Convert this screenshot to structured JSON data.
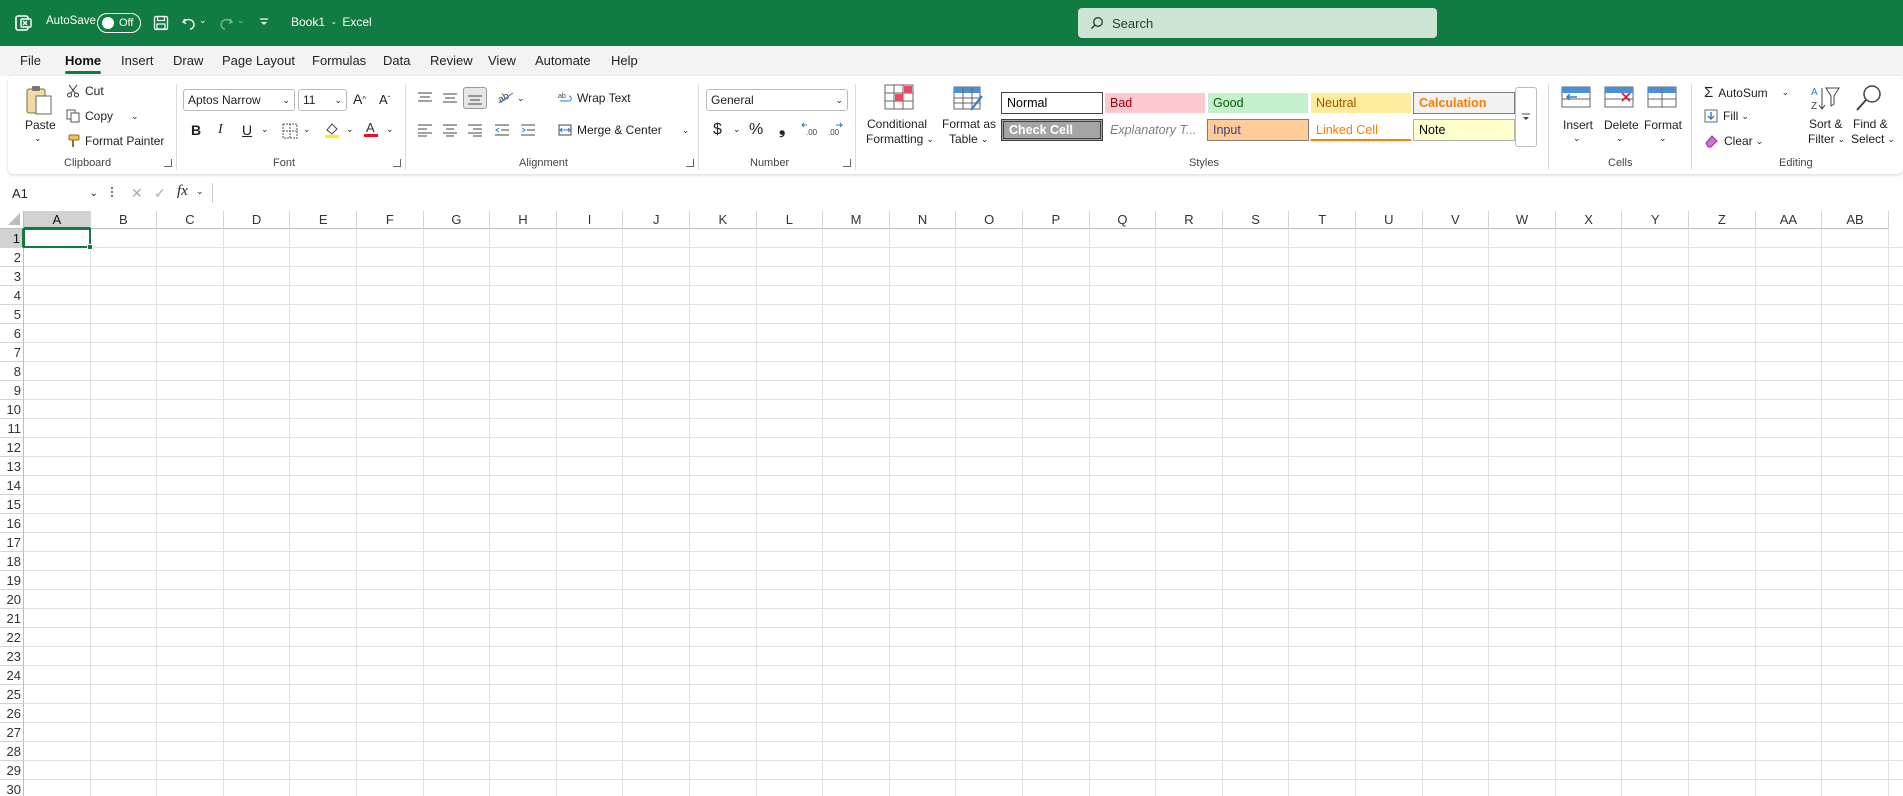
{
  "titlebar": {
    "autosave_label": "AutoSave",
    "autosave_state": "Off",
    "doc_title": "Book1",
    "separator": "-",
    "app_name": "Excel",
    "search_placeholder": "Search"
  },
  "menu": [
    "File",
    "Home",
    "Insert",
    "Draw",
    "Page Layout",
    "Formulas",
    "Data",
    "Review",
    "View",
    "Automate",
    "Help"
  ],
  "clipboard": {
    "paste": "Paste",
    "cut": "Cut",
    "copy": "Copy",
    "format_painter": "Format Painter",
    "group": "Clipboard"
  },
  "font": {
    "name": "Aptos Narrow",
    "size": "11",
    "bold": "B",
    "italic": "I",
    "underline": "U",
    "group": "Font"
  },
  "alignment": {
    "wrap": "Wrap Text",
    "merge": "Merge & Center",
    "group": "Alignment"
  },
  "number": {
    "format": "General",
    "currency": "$",
    "percent": "%",
    "comma": "❟",
    "group": "Number"
  },
  "styles": {
    "conditional_1": "Conditional",
    "conditional_2": "Formatting",
    "format_table_1": "Format as",
    "format_table_2": "Table",
    "cells": [
      {
        "label": "Normal",
        "bg": "#ffffff",
        "fg": "#000000"
      },
      {
        "label": "Bad",
        "bg": "#ffc7ce",
        "fg": "#9c0006"
      },
      {
        "label": "Good",
        "bg": "#c6efce",
        "fg": "#006100"
      },
      {
        "label": "Neutral",
        "bg": "#ffeb9c",
        "fg": "#9c5700"
      },
      {
        "label": "Calculation",
        "bg": "#f2f2f2",
        "fg": "#fa7d00"
      },
      {
        "label": "Check Cell",
        "bg": "#a5a5a5",
        "fg": "#ffffff"
      },
      {
        "label": "Explanatory T...",
        "bg": "#ffffff",
        "fg": "#7f7f7f"
      },
      {
        "label": "Input",
        "bg": "#ffcc99",
        "fg": "#3f3f76"
      },
      {
        "label": "Linked Cell",
        "bg": "#ffffff",
        "fg": "#fa7d00"
      },
      {
        "label": "Note",
        "bg": "#ffffcc",
        "fg": "#000000"
      }
    ],
    "group": "Styles"
  },
  "cells_group": {
    "insert": "Insert",
    "delete": "Delete",
    "format": "Format",
    "group": "Cells"
  },
  "editing": {
    "autosum": "AutoSum",
    "fill": "Fill",
    "clear": "Clear",
    "sort_1": "Sort &",
    "sort_2": "Filter",
    "find_1": "Find &",
    "find_2": "Select",
    "group": "Editing"
  },
  "formula": {
    "name_box": "A1",
    "fx": "fx",
    "content": ""
  },
  "sheet": {
    "columns": [
      "A",
      "B",
      "C",
      "D",
      "E",
      "F",
      "G",
      "H",
      "I",
      "J",
      "K",
      "L",
      "M",
      "N",
      "O",
      "P",
      "Q",
      "R",
      "S",
      "T",
      "U",
      "V",
      "W",
      "X",
      "Y",
      "Z",
      "AA",
      "AB"
    ],
    "rows": [
      "1",
      "2",
      "3",
      "4",
      "5",
      "6",
      "7",
      "8",
      "9",
      "10",
      "11",
      "12",
      "13",
      "14",
      "15",
      "16",
      "17",
      "18",
      "19",
      "20",
      "21",
      "22",
      "23",
      "24",
      "25",
      "26",
      "27",
      "28",
      "29",
      "30"
    ],
    "selected_cell": "A1"
  },
  "colors": {
    "accent": "#107c41",
    "search_bg": "#cde4d5"
  }
}
